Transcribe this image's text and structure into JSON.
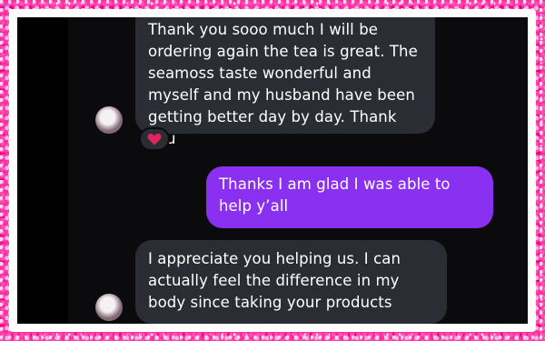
{
  "conversation": {
    "messages": [
      {
        "direction": "incoming",
        "text": "Thank you sooo much I will be ordering again the tea is great. The seamoss taste wonderful and myself and my husband have been getting better day by day. Thank you",
        "reaction": "heart"
      },
      {
        "direction": "outgoing",
        "text": "Thanks I am glad I was able to help y’all"
      },
      {
        "direction": "incoming",
        "text": "I appreciate you helping us. I can actually feel the difference in my body since taking your products"
      }
    ]
  },
  "colors": {
    "incoming_bubble": "#2a2d34",
    "outgoing_bubble": "#8a30f0",
    "frame": "#ff2fa0",
    "heart": "#e0245e"
  }
}
